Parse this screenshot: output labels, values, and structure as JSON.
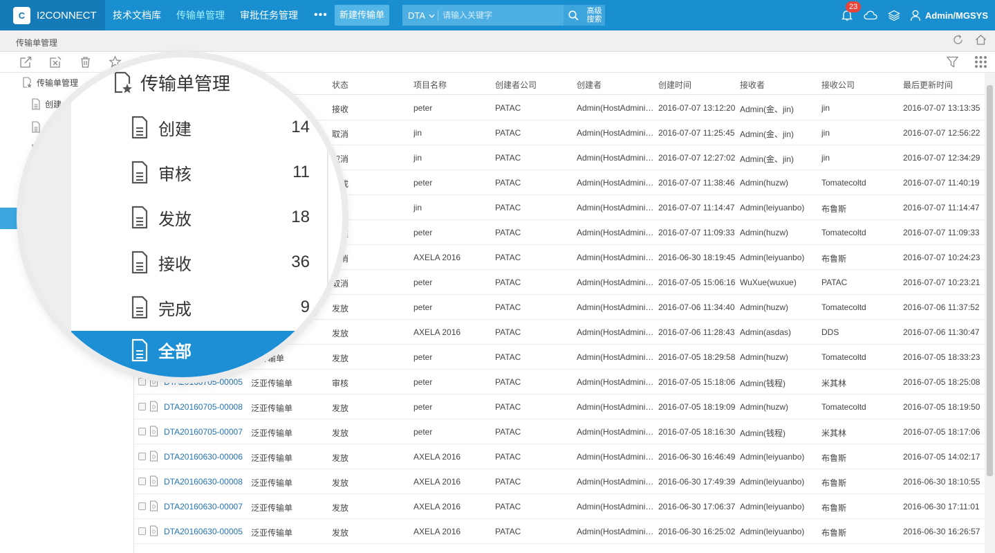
{
  "app": {
    "brand_logo": "C",
    "brand_name": "I2CONNECT",
    "nav": [
      "技术文档库",
      "传输单管理",
      "审批任务管理"
    ],
    "nav_more": "•••",
    "new_button": "新建传输单",
    "search_type": "DTA",
    "search_placeholder": "请输入关键字",
    "adv_search": "高级搜索",
    "notifications": "23",
    "user": "Admin/MGSYS"
  },
  "breadcrumb": "传输单管理",
  "sidebar": {
    "root": "传输单管理",
    "items": [
      "创建",
      "审",
      "发"
    ]
  },
  "magnifier": {
    "title": "传输单管理",
    "items": [
      {
        "label": "创建",
        "count": "14"
      },
      {
        "label": "审核",
        "count": "11"
      },
      {
        "label": "发放",
        "count": "18"
      },
      {
        "label": "接收",
        "count": "36"
      },
      {
        "label": "完成",
        "count": "9"
      }
    ],
    "active": "全部"
  },
  "table": {
    "headers": [
      "状态",
      "项目名称",
      "创建者公司",
      "创建者",
      "创建时间",
      "接收者",
      "接收公司",
      "最后更新时间"
    ],
    "rows": [
      {
        "id": "",
        "type": "",
        "status": "接收",
        "project": "peter",
        "company": "PATAC",
        "creator": "Admin(HostAdmini…",
        "created": "2016-07-07 13:12:20",
        "receiver": "Admin(金、jin)",
        "rcompany": "jin",
        "updated": "2016-07-07 13:13:35"
      },
      {
        "id": "",
        "type": "",
        "status": "取消",
        "project": "jin",
        "company": "PATAC",
        "creator": "Admin(HostAdmini…",
        "created": "2016-07-07 11:25:45",
        "receiver": "Admin(金、jin)",
        "rcompany": "jin",
        "updated": "2016-07-07 12:56:22"
      },
      {
        "id": "",
        "type": "",
        "status": "取消",
        "project": "jin",
        "company": "PATAC",
        "creator": "Admin(HostAdmini…",
        "created": "2016-07-07 12:27:02",
        "receiver": "Admin(金、jin)",
        "rcompany": "jin",
        "updated": "2016-07-07 12:34:29"
      },
      {
        "id": "",
        "type": "",
        "status": "完成",
        "project": "peter",
        "company": "PATAC",
        "creator": "Admin(HostAdmini…",
        "created": "2016-07-07 11:38:46",
        "receiver": "Admin(huzw)",
        "rcompany": "Tomatecoltd",
        "updated": "2016-07-07 11:40:19"
      },
      {
        "id": "",
        "type": "",
        "status": "创建",
        "project": "jin",
        "company": "PATAC",
        "creator": "Admin(HostAdmini…",
        "created": "2016-07-07 11:14:47",
        "receiver": "Admin(leiyuanbo)",
        "rcompany": "布鲁斯",
        "updated": "2016-07-07 11:14:47"
      },
      {
        "id": "",
        "type": "",
        "status": "创建",
        "project": "peter",
        "company": "PATAC",
        "creator": "Admin(HostAdmini…",
        "created": "2016-07-07 11:09:33",
        "receiver": "Admin(huzw)",
        "rcompany": "Tomatecoltd",
        "updated": "2016-07-07 11:09:33"
      },
      {
        "id": "",
        "type": "",
        "status": "取消",
        "project": "AXELA 2016",
        "company": "PATAC",
        "creator": "Admin(HostAdmini…",
        "created": "2016-06-30 18:19:45",
        "receiver": "Admin(leiyuanbo)",
        "rcompany": "布鲁斯",
        "updated": "2016-07-07 10:24:23"
      },
      {
        "id": "",
        "type": "",
        "status": "取消",
        "project": "peter",
        "company": "PATAC",
        "creator": "Admin(HostAdmini…",
        "created": "2016-07-05 15:06:16",
        "receiver": "WuXue(wuxue)",
        "rcompany": "PATAC",
        "updated": "2016-07-07 10:23:21"
      },
      {
        "id": "",
        "type": "",
        "status": "发放",
        "project": "peter",
        "company": "PATAC",
        "creator": "Admin(HostAdmini…",
        "created": "2016-07-06 11:34:40",
        "receiver": "Admin(huzw)",
        "rcompany": "Tomatecoltd",
        "updated": "2016-07-06 11:37:52"
      },
      {
        "id": "",
        "type": "",
        "status": "发放",
        "project": "AXELA 2016",
        "company": "PATAC",
        "creator": "Admin(HostAdmini…",
        "created": "2016-07-06 11:28:43",
        "receiver": "Admin(asdas)",
        "rcompany": "DDS",
        "updated": "2016-07-06 11:30:47"
      },
      {
        "id": "",
        "type": "亚传输单",
        "status": "发放",
        "project": "peter",
        "company": "PATAC",
        "creator": "Admin(HostAdmini…",
        "created": "2016-07-05 18:29:58",
        "receiver": "Admin(huzw)",
        "rcompany": "Tomatecoltd",
        "updated": "2016-07-05 18:33:23"
      },
      {
        "id": "DTA20160705-00005",
        "type": "泛亚传输单",
        "status": "审核",
        "project": "peter",
        "company": "PATAC",
        "creator": "Admin(HostAdmini…",
        "created": "2016-07-05 15:18:06",
        "receiver": "Admin(钱程)",
        "rcompany": "米其林",
        "updated": "2016-07-05 18:25:08"
      },
      {
        "id": "DTA20160705-00008",
        "type": "泛亚传输单",
        "status": "发放",
        "project": "peter",
        "company": "PATAC",
        "creator": "Admin(HostAdmini…",
        "created": "2016-07-05 18:19:09",
        "receiver": "Admin(huzw)",
        "rcompany": "Tomatecoltd",
        "updated": "2016-07-05 18:19:50"
      },
      {
        "id": "DTA20160705-00007",
        "type": "泛亚传输单",
        "status": "发放",
        "project": "peter",
        "company": "PATAC",
        "creator": "Admin(HostAdmini…",
        "created": "2016-07-05 18:16:30",
        "receiver": "Admin(钱程)",
        "rcompany": "米其林",
        "updated": "2016-07-05 18:17:06"
      },
      {
        "id": "DTA20160630-00006",
        "type": "泛亚传输单",
        "status": "发放",
        "project": "AXELA 2016",
        "company": "PATAC",
        "creator": "Admin(HostAdmini…",
        "created": "2016-06-30 16:46:49",
        "receiver": "Admin(leiyuanbo)",
        "rcompany": "布鲁斯",
        "updated": "2016-07-05 14:02:17"
      },
      {
        "id": "DTA20160630-00008",
        "type": "泛亚传输单",
        "status": "发放",
        "project": "AXELA 2016",
        "company": "PATAC",
        "creator": "Admin(HostAdmini…",
        "created": "2016-06-30 17:49:39",
        "receiver": "Admin(leiyuanbo)",
        "rcompany": "布鲁斯",
        "updated": "2016-06-30 18:10:55"
      },
      {
        "id": "DTA20160630-00007",
        "type": "泛亚传输单",
        "status": "发放",
        "project": "AXELA 2016",
        "company": "PATAC",
        "creator": "Admin(HostAdmini…",
        "created": "2016-06-30 17:06:37",
        "receiver": "Admin(leiyuanbo)",
        "rcompany": "布鲁斯",
        "updated": "2016-06-30 17:11:01"
      },
      {
        "id": "DTA20160630-00005",
        "type": "泛亚传输单",
        "status": "发放",
        "project": "AXELA 2016",
        "company": "PATAC",
        "creator": "Admin(HostAdmini…",
        "created": "2016-06-30 16:25:02",
        "receiver": "Admin(leiyuanbo)",
        "rcompany": "布鲁斯",
        "updated": "2016-06-30 16:26:57"
      }
    ]
  },
  "colors": {
    "topbar": "#1a8fd0",
    "brand_bg": "#157bb8",
    "active_nav": "#9ff0ff",
    "link": "#2473b2",
    "badge": "#e8433a",
    "sidebar_active": "#3ba7e0"
  },
  "icons": [
    "notification-bell-icon",
    "cloud-icon",
    "layers-icon",
    "user-icon",
    "refresh-icon",
    "home-icon",
    "edit-icon",
    "cancel-icon",
    "delete-icon",
    "star-icon",
    "filter-icon",
    "grid-icon",
    "document-icon",
    "search-icon"
  ]
}
